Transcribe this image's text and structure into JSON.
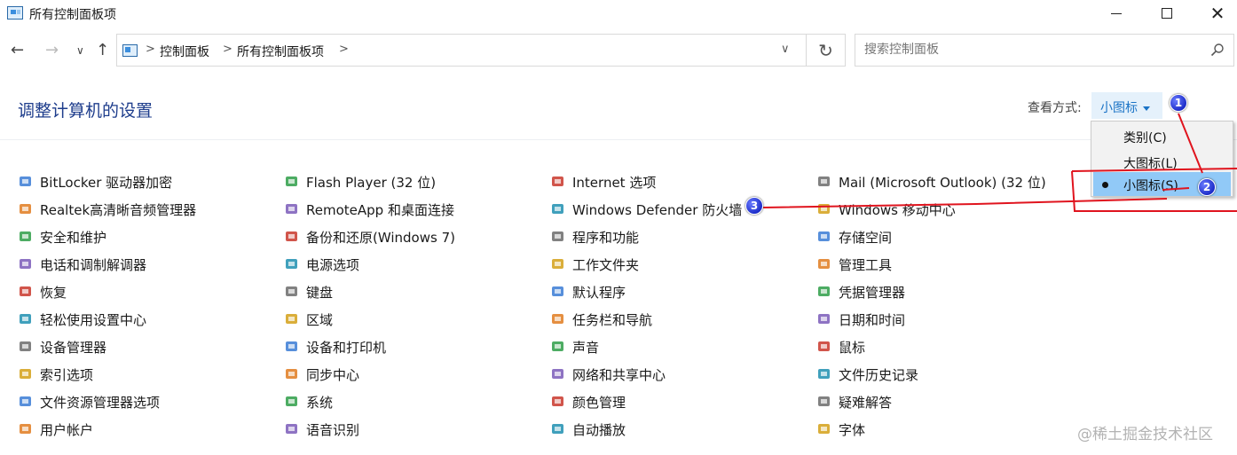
{
  "window": {
    "title": "所有控制面板项",
    "minimize_icon": "minimize-icon",
    "maximize_icon": "maximize-icon",
    "close_icon": "close-icon",
    "close_glyph": "✕"
  },
  "nav": {
    "back_glyph": "←",
    "forward_glyph": "→",
    "recent_glyph": "∨",
    "up_glyph": "↑",
    "breadcrumbs": [
      "控制面板",
      "所有控制面板项"
    ],
    "separator": ">",
    "dropdown_glyph": "∨",
    "refresh_glyph": "↻",
    "search_placeholder": "搜索控制面板"
  },
  "header": {
    "title": "调整计算机的设置",
    "view_by_label": "查看方式:",
    "view_by_value": "小图标"
  },
  "view_menu": {
    "items": [
      "类别(C)",
      "大图标(L)",
      "小图标(S)"
    ],
    "selected": "小图标(S)"
  },
  "annotations": {
    "badges": [
      "1",
      "2",
      "3"
    ],
    "line_color": "#e0141e",
    "badge_color": "#1d2dc9"
  },
  "columns": [
    [
      {
        "label": "BitLocker 驱动器加密",
        "icon": "bitlocker-icon"
      },
      {
        "label": "Realtek高清晰音频管理器",
        "icon": "realtek-audio-icon"
      },
      {
        "label": "安全和维护",
        "icon": "flag-icon"
      },
      {
        "label": "电话和调制解调器",
        "icon": "phone-modem-icon"
      },
      {
        "label": "恢复",
        "icon": "recovery-icon"
      },
      {
        "label": "轻松使用设置中心",
        "icon": "ease-of-access-icon"
      },
      {
        "label": "设备管理器",
        "icon": "device-manager-icon"
      },
      {
        "label": "索引选项",
        "icon": "indexing-icon"
      },
      {
        "label": "文件资源管理器选项",
        "icon": "folder-options-icon"
      },
      {
        "label": "用户帐户",
        "icon": "user-accounts-icon"
      }
    ],
    [
      {
        "label": "Flash Player (32 位)",
        "icon": "flash-player-icon"
      },
      {
        "label": "RemoteApp 和桌面连接",
        "icon": "remoteapp-icon"
      },
      {
        "label": "备份和还原(Windows 7)",
        "icon": "backup-restore-icon"
      },
      {
        "label": "电源选项",
        "icon": "power-options-icon"
      },
      {
        "label": "键盘",
        "icon": "keyboard-icon"
      },
      {
        "label": "区域",
        "icon": "region-icon"
      },
      {
        "label": "设备和打印机",
        "icon": "printer-icon"
      },
      {
        "label": "同步中心",
        "icon": "sync-center-icon"
      },
      {
        "label": "系统",
        "icon": "system-icon"
      },
      {
        "label": "语音识别",
        "icon": "microphone-icon"
      }
    ],
    [
      {
        "label": "Internet 选项",
        "icon": "internet-options-icon"
      },
      {
        "label": "Windows Defender 防火墙",
        "icon": "firewall-icon"
      },
      {
        "label": "程序和功能",
        "icon": "programs-features-icon"
      },
      {
        "label": "工作文件夹",
        "icon": "work-folders-icon"
      },
      {
        "label": "默认程序",
        "icon": "default-programs-icon"
      },
      {
        "label": "任务栏和导航",
        "icon": "taskbar-icon"
      },
      {
        "label": "声音",
        "icon": "sound-icon"
      },
      {
        "label": "网络和共享中心",
        "icon": "network-sharing-icon"
      },
      {
        "label": "颜色管理",
        "icon": "color-management-icon"
      },
      {
        "label": "自动播放",
        "icon": "autoplay-icon"
      }
    ],
    [
      {
        "label": "Mail (Microsoft Outlook) (32 位)",
        "icon": "mail-icon"
      },
      {
        "label": "Windows 移动中心",
        "icon": "mobility-center-icon"
      },
      {
        "label": "存储空间",
        "icon": "storage-spaces-icon"
      },
      {
        "label": "管理工具",
        "icon": "admin-tools-icon"
      },
      {
        "label": "凭据管理器",
        "icon": "credential-manager-icon"
      },
      {
        "label": "日期和时间",
        "icon": "date-time-icon"
      },
      {
        "label": "鼠标",
        "icon": "mouse-icon"
      },
      {
        "label": "文件历史记录",
        "icon": "file-history-icon"
      },
      {
        "label": "疑难解答",
        "icon": "troubleshooting-icon"
      },
      {
        "label": "字体",
        "icon": "fonts-icon"
      }
    ]
  ],
  "watermark": "@稀土掘金技术社区"
}
